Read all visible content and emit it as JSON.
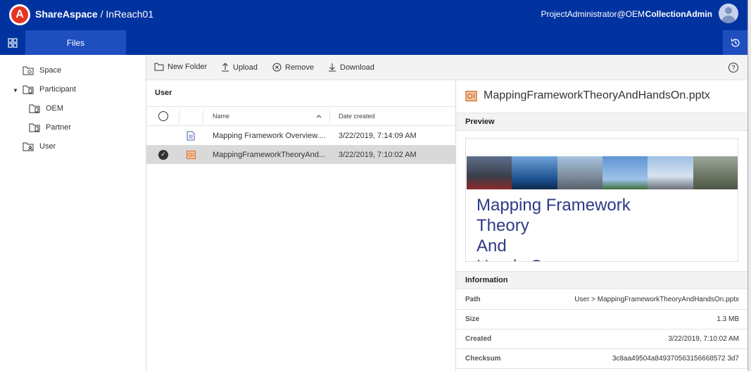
{
  "header": {
    "logo_letter": "A",
    "brand": "ShareAspace",
    "breadcrumb_sep": " / ",
    "database": "InReach01",
    "user_email": "ProjectAdministrator@OEM",
    "user_role": "CollectionAdmin"
  },
  "nav": {
    "tabs": [
      {
        "label": "Files"
      }
    ]
  },
  "tree": {
    "items": [
      {
        "label": "Space"
      },
      {
        "label": "Participant"
      },
      {
        "label": "OEM"
      },
      {
        "label": "Partner"
      },
      {
        "label": "User"
      }
    ]
  },
  "toolbar": {
    "new_folder": "New Folder",
    "upload": "Upload",
    "remove": "Remove",
    "download": "Download",
    "help": "?"
  },
  "list": {
    "title": "User",
    "columns": {
      "name": "Name",
      "date": "Date created"
    },
    "rows": [
      {
        "name": "Mapping Framework Overview....",
        "date": "3/22/2019, 7:14:09 AM",
        "selected": false
      },
      {
        "name": "MappingFrameworkTheoryAnd...",
        "date": "3/22/2019, 7:10:02 AM",
        "selected": true
      }
    ]
  },
  "detail": {
    "title": "MappingFrameworkTheoryAndHandsOn.pptx",
    "preview_label": "Preview",
    "slide_lines": [
      "Mapping Framework",
      "Theory",
      "And",
      "Hands On"
    ],
    "information_label": "Information",
    "info": [
      {
        "label": "Path",
        "value": "User > MappingFrameworkTheoryAndHandsOn.pptx"
      },
      {
        "label": "Size",
        "value": "1.3 MB"
      },
      {
        "label": "Created",
        "value": "3/22/2019, 7:10:02 AM"
      },
      {
        "label": "Checksum",
        "value": "3c8aa49504a849370563156668572 3d7"
      }
    ]
  },
  "colors": {
    "header_bg": "#0033a0",
    "active_tab": "#1f4fbf",
    "logo_red": "#e63323",
    "selected_row": "#d9d9d9",
    "slide_text": "#2e3a87"
  }
}
